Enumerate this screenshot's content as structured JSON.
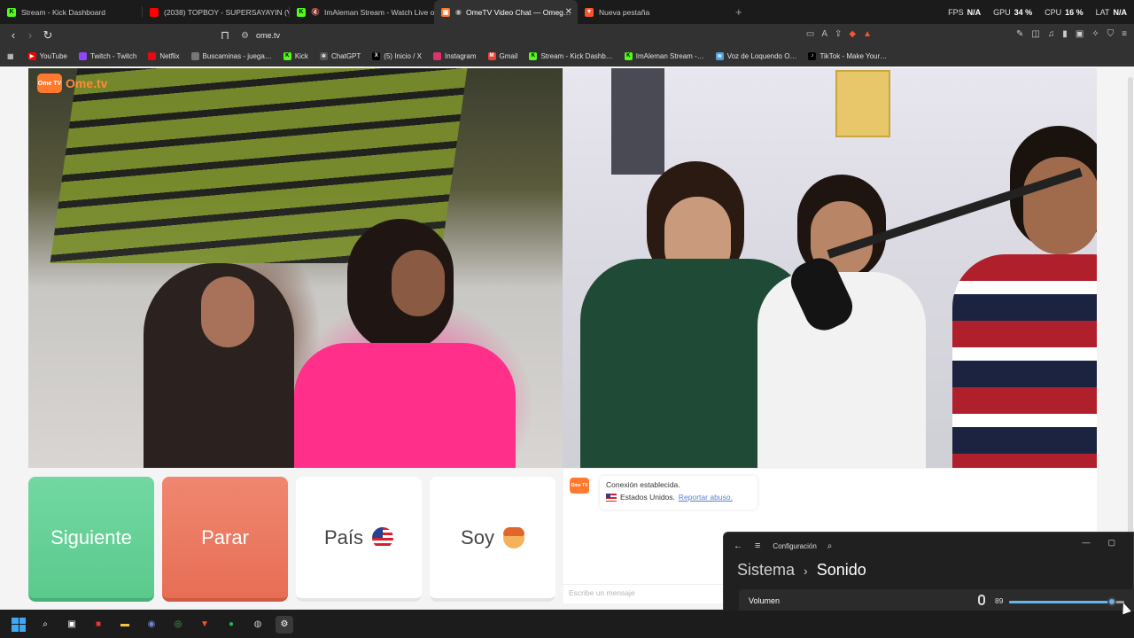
{
  "browser": {
    "tabs": [
      {
        "title": "Stream - Kick Dashboard",
        "icon": "kick-icon",
        "color": "#53fc18",
        "active": false
      },
      {
        "title": "(2038) TOPBOY - SUPERSAYAYIN (Vi…",
        "icon": "youtube-icon",
        "color": "#ff0000",
        "active": false
      },
      {
        "title": "ImAleman Stream - Watch Live o…",
        "icon": "kick-icon",
        "color": "#53fc18",
        "active": false
      },
      {
        "title": "OmeTV Video Chat — Omeg…",
        "icon": "ometv-icon",
        "color": "#ff7a2f",
        "active": true
      },
      {
        "title": "Nueva pestaña",
        "icon": "brave-icon",
        "color": "#fb542b",
        "active": false
      }
    ],
    "perf": {
      "fps_label": "FPS",
      "fps_value": "N/A",
      "gpu_label": "GPU",
      "gpu_value": "34 %",
      "cpu_label": "CPU",
      "cpu_value": "16 %",
      "lat_label": "LAT",
      "lat_value": "N/A"
    },
    "url": "ome.tv",
    "bookmarks": [
      {
        "label": "YouTube",
        "icon": "youtube-icon",
        "color": "#ff0000"
      },
      {
        "label": "Twitch - Twitch",
        "icon": "twitch-icon",
        "color": "#9146ff"
      },
      {
        "label": "Netflix",
        "icon": "netflix-icon",
        "color": "#e50914"
      },
      {
        "label": "Buscaminas - juega…",
        "icon": "minesweeper-icon",
        "color": "#777777"
      },
      {
        "label": "Kick",
        "icon": "kick-icon",
        "color": "#53fc18"
      },
      {
        "label": "ChatGPT",
        "icon": "chatgpt-icon",
        "color": "#aaaaaa"
      },
      {
        "label": "(5) Inicio / X",
        "icon": "x-icon",
        "color": "#ffffff"
      },
      {
        "label": "Instagram",
        "icon": "instagram-icon",
        "color": "#e1306c"
      },
      {
        "label": "Gmail",
        "icon": "gmail-icon",
        "color": "#ea4335"
      },
      {
        "label": "Stream - Kick Dashb…",
        "icon": "kick-icon",
        "color": "#53fc18"
      },
      {
        "label": "ImAleman Stream -…",
        "icon": "kick-icon",
        "color": "#53fc18"
      },
      {
        "label": "Voz de Loquendo O…",
        "icon": "audio-icon",
        "color": "#4aa3df"
      },
      {
        "label": "TikTok - Make Your…",
        "icon": "tiktok-icon",
        "color": "#000000"
      }
    ]
  },
  "ometv": {
    "logo": "Ome.tv",
    "logo_badge": "Ome TV",
    "buttons": {
      "next": "Siguiente",
      "stop": "Parar",
      "country": "País",
      "me": "Soy"
    },
    "chat": {
      "system_line1": "Conexión establecida.",
      "system_country": "Estados Unidos.",
      "report_link": "Reportar abuso.",
      "input_placeholder": "Escribe un mensaje"
    },
    "colors": {
      "next": "#5bc98c",
      "stop": "#e76e55",
      "brand": "#ff7a2f"
    }
  },
  "settings": {
    "title": "Configuración",
    "breadcrumb_parent": "Sistema",
    "breadcrumb_current": "Sonido",
    "volume_label": "Volumen",
    "volume_value": "89",
    "volume_level": 0.89
  },
  "taskbar": {
    "items": [
      "windows-start",
      "search",
      "task-view",
      "app-red",
      "file-explorer",
      "discord",
      "chrome",
      "brave",
      "spotify",
      "obs",
      "settings"
    ]
  }
}
